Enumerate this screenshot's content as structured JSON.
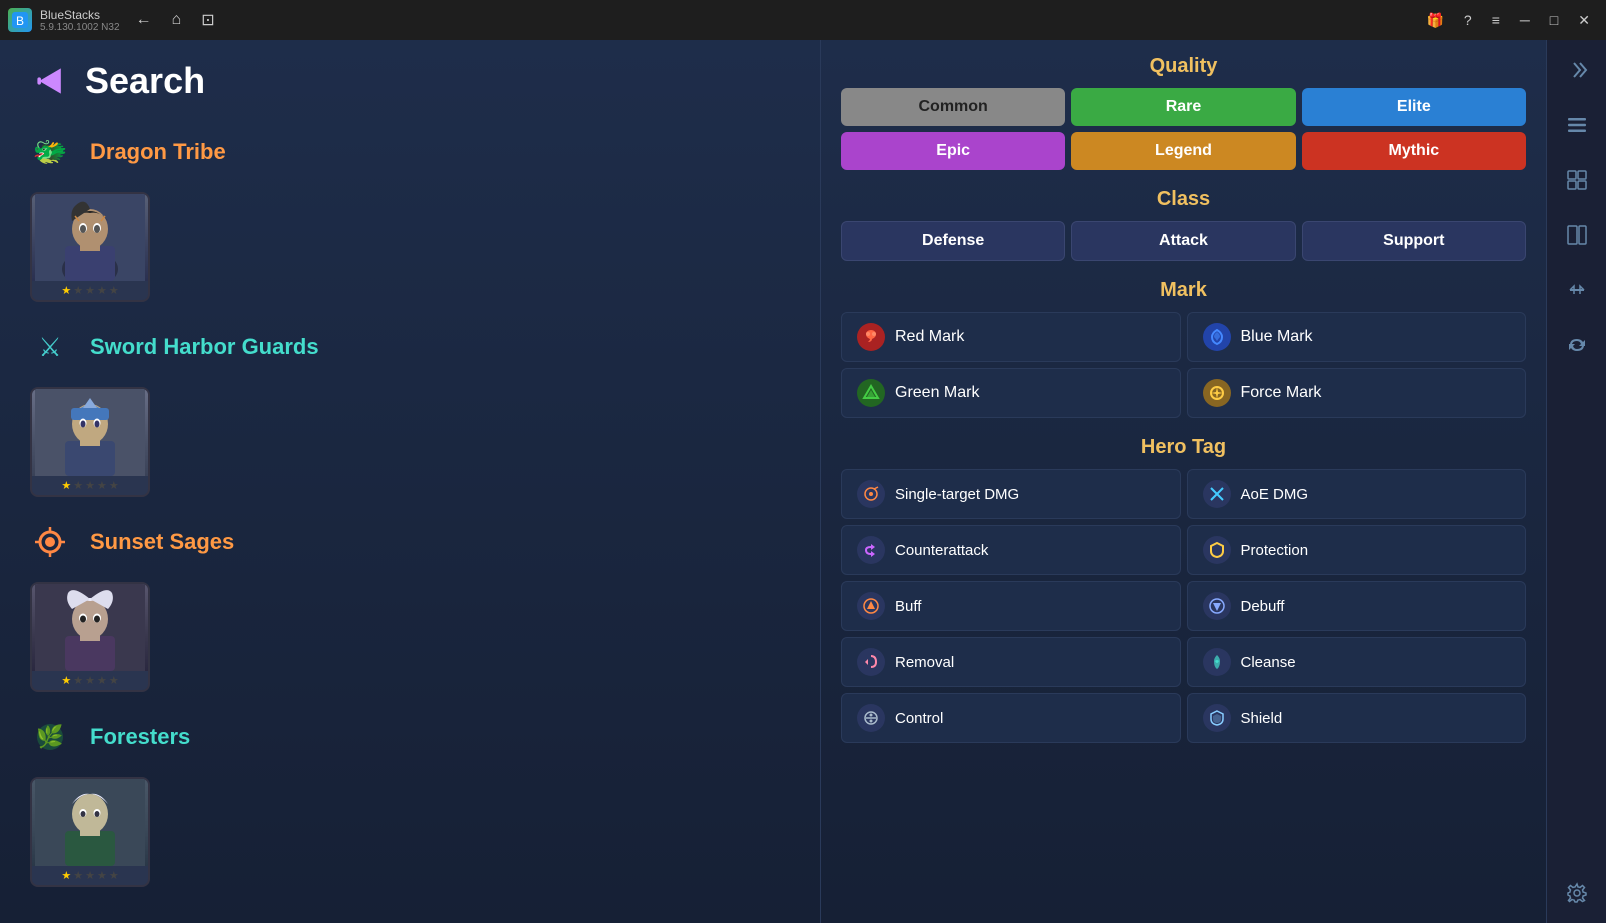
{
  "titlebar": {
    "app_name": "BlueStacks",
    "version": "5.9.130.1002  N32",
    "back_label": "←",
    "home_label": "⌂",
    "tabs_label": "⊡",
    "gift_label": "🎁",
    "help_label": "?",
    "menu_label": "≡",
    "minimize_label": "─",
    "maximize_label": "□",
    "close_label": "✕",
    "side_label": "◁▷"
  },
  "header": {
    "back_arrow": "◀",
    "title": "Search"
  },
  "factions": [
    {
      "id": "dragon-tribe",
      "name": "Dragon Tribe",
      "icon_color": "orange",
      "hero": {
        "stars": [
          1,
          1,
          1,
          1,
          1
        ],
        "filled": 1
      }
    },
    {
      "id": "sword-harbor",
      "name": "Sword Harbor Guards",
      "icon_color": "teal",
      "hero": {
        "stars": [
          1,
          1,
          1,
          1,
          1
        ],
        "filled": 1
      }
    },
    {
      "id": "sunset-sages",
      "name": "Sunset Sages",
      "icon_color": "orange",
      "hero": {
        "stars": [
          1,
          1,
          1,
          1,
          1
        ],
        "filled": 1
      }
    },
    {
      "id": "foresters",
      "name": "Foresters",
      "icon_color": "teal",
      "hero": {
        "stars": [
          1,
          1,
          1,
          1,
          1
        ],
        "filled": 1
      }
    }
  ],
  "quality": {
    "section_title": "Quality",
    "buttons": [
      {
        "id": "common",
        "label": "Common",
        "style": "gray"
      },
      {
        "id": "rare",
        "label": "Rare",
        "style": "green"
      },
      {
        "id": "elite",
        "label": "Elite",
        "style": "blue"
      },
      {
        "id": "epic",
        "label": "Epic",
        "style": "purple"
      },
      {
        "id": "legend",
        "label": "Legend",
        "style": "orange"
      },
      {
        "id": "mythic",
        "label": "Mythic",
        "style": "red"
      }
    ]
  },
  "class": {
    "section_title": "Class",
    "buttons": [
      {
        "id": "defense",
        "label": "Defense",
        "style": "dark"
      },
      {
        "id": "attack",
        "label": "Attack",
        "style": "dark"
      },
      {
        "id": "support",
        "label": "Support",
        "style": "dark"
      }
    ]
  },
  "mark": {
    "section_title": "Mark",
    "items": [
      {
        "id": "red-mark",
        "label": "Red Mark",
        "icon": "🐾",
        "icon_style": "red"
      },
      {
        "id": "blue-mark",
        "label": "Blue Mark",
        "icon": "🌀",
        "icon_style": "blue"
      },
      {
        "id": "green-mark",
        "label": "Green Mark",
        "icon": "🔺",
        "icon_style": "green"
      },
      {
        "id": "force-mark",
        "label": "Force Mark",
        "icon": "✦",
        "icon_style": "gold"
      }
    ]
  },
  "hero_tag": {
    "section_title": "Hero Tag",
    "items": [
      {
        "id": "single-target-dmg",
        "label": "Single-target DMG",
        "icon": "🎯",
        "icon_color": "orange"
      },
      {
        "id": "aoe-dmg",
        "label": "AoE DMG",
        "icon": "✖",
        "icon_color": "cyan"
      },
      {
        "id": "counterattack",
        "label": "Counterattack",
        "icon": "⇄",
        "icon_color": "purple"
      },
      {
        "id": "protection",
        "label": "Protection",
        "icon": "🛡",
        "icon_color": "yellow"
      },
      {
        "id": "buff",
        "label": "Buff",
        "icon": "↑",
        "icon_color": "orange"
      },
      {
        "id": "debuff",
        "label": "Debuff",
        "icon": "↓",
        "icon_color": "lightblue"
      },
      {
        "id": "removal",
        "label": "Removal",
        "icon": "↺",
        "icon_color": "pink"
      },
      {
        "id": "cleanse",
        "label": "Cleanse",
        "icon": "♥",
        "icon_color": "teal"
      },
      {
        "id": "control",
        "label": "Control",
        "icon": "⛓",
        "icon_color": "gray"
      },
      {
        "id": "shield",
        "label": "Shield",
        "icon": "🛡",
        "icon_color": "shield"
      }
    ]
  },
  "right_sidebar": {
    "icons": [
      {
        "id": "icon1",
        "symbol": "◁▷"
      },
      {
        "id": "icon2",
        "symbol": "◈"
      },
      {
        "id": "icon3",
        "symbol": "⊞"
      },
      {
        "id": "icon4",
        "symbol": "◧"
      },
      {
        "id": "icon5",
        "symbol": "↔"
      },
      {
        "id": "icon6",
        "symbol": "⟳"
      },
      {
        "id": "icon7",
        "symbol": "⚙"
      },
      {
        "id": "icon8",
        "symbol": "⚙"
      }
    ]
  }
}
